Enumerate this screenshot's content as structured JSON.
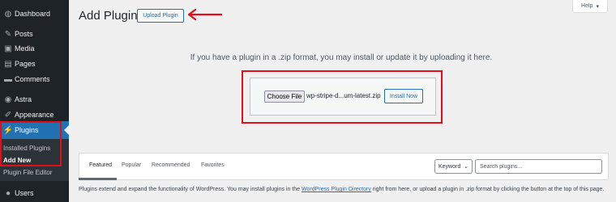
{
  "sidebar": {
    "items": [
      {
        "label": "Dashboard",
        "icon": "dashboard-icon",
        "glyph": "◍"
      },
      {
        "label": "Posts",
        "icon": "pushpin-icon",
        "glyph": "✎"
      },
      {
        "label": "Media",
        "icon": "media-icon",
        "glyph": "▣"
      },
      {
        "label": "Pages",
        "icon": "pages-icon",
        "glyph": "▤"
      },
      {
        "label": "Comments",
        "icon": "comments-icon",
        "glyph": "▬"
      },
      {
        "label": "Astra",
        "icon": "astra-icon",
        "glyph": "◉"
      },
      {
        "label": "Appearance",
        "icon": "brush-icon",
        "glyph": "✐"
      },
      {
        "label": "Plugins",
        "icon": "plug-icon",
        "glyph": "⚡"
      },
      {
        "label": "Users",
        "icon": "users-icon",
        "glyph": "●"
      }
    ],
    "submenu": [
      "Installed Plugins",
      "Add New",
      "Plugin File Editor"
    ]
  },
  "header": {
    "title": "Add Plugins",
    "upload_label": "Upload Plugin",
    "help_label": "Help"
  },
  "upload": {
    "message": "If you have a plugin in a .zip format, you may install or update it by uploading it here.",
    "choose_label": "Choose File",
    "file_name": "wp-stripe-d...um-latest.zip",
    "install_label": "Install Now"
  },
  "filter": {
    "tabs": [
      "Featured",
      "Popular",
      "Recommended",
      "Favorites"
    ],
    "keyword_label": "Keyword",
    "search_placeholder": "Search plugins..."
  },
  "description": {
    "before": "Plugins extend and expand the functionality of WordPress. You may install plugins in the ",
    "link": "WordPress Plugin Directory",
    "after": " right from here, or upload a plugin in .zip format by clicking the button at the top of this page."
  },
  "colors": {
    "accent": "#2271b1",
    "sidebar_bg": "#1d2327",
    "annotation_red": "#e0101a"
  }
}
